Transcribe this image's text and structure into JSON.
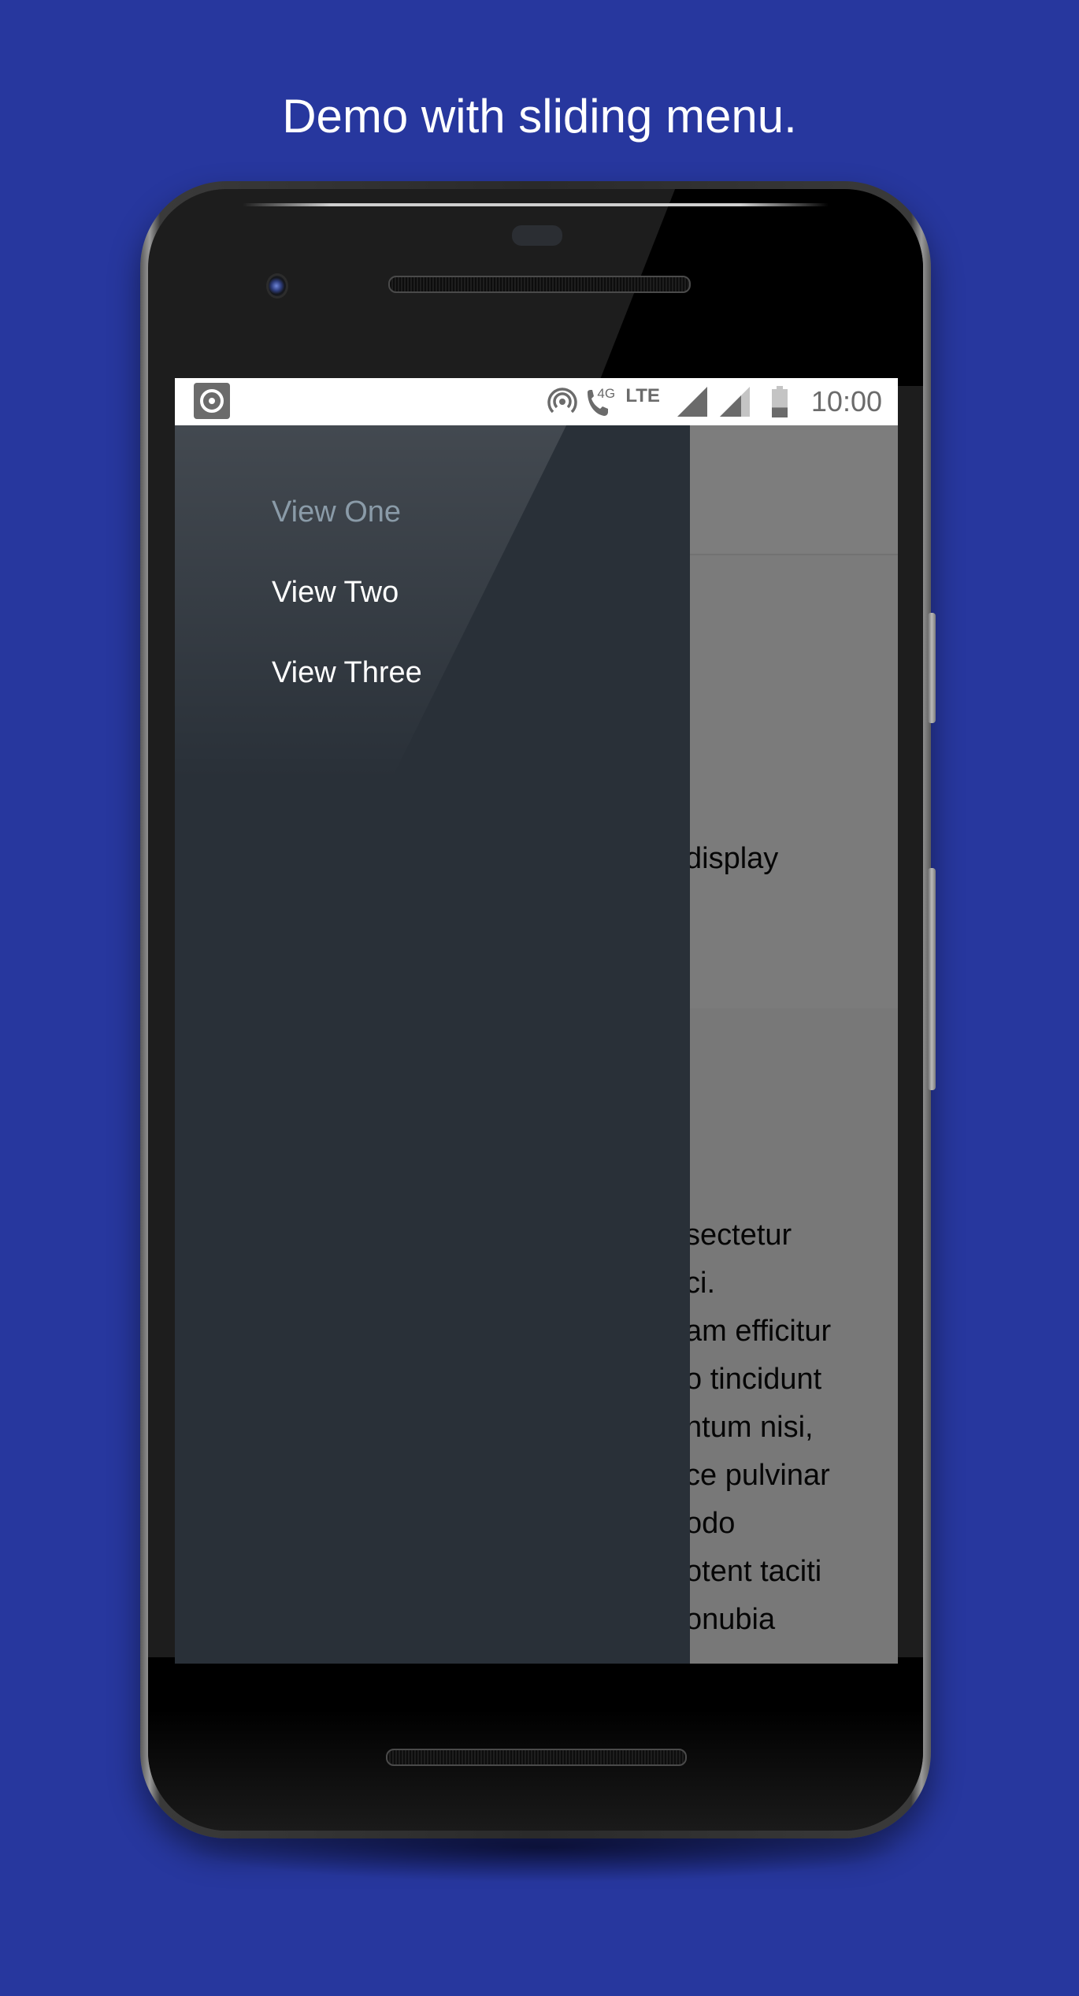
{
  "caption": "Demo with sliding menu.",
  "status_bar": {
    "app_icon": "notification-app-icon",
    "icons": [
      "hotspot-icon",
      "wifi-calling-icon",
      "lte-icon",
      "signal-icon",
      "signal-partial-icon",
      "battery-icon"
    ],
    "call_label": "4G",
    "network_label": "LTE",
    "time": "10:00",
    "battery_level_percent": 35
  },
  "drawer": {
    "items": [
      {
        "label": "View One",
        "active": true
      },
      {
        "label": "View Two",
        "active": false
      },
      {
        "label": "View Three",
        "active": false
      }
    ]
  },
  "main_content": {
    "heading_fragment": "display",
    "paragraph_fragments": [
      "sectetur",
      "ci.",
      "am efficitur",
      "o tincidunt",
      "ntum nisi,",
      "ce pulvinar",
      "odo",
      "otent taciti",
      "onubia"
    ]
  },
  "colors": {
    "background": "#27379e",
    "drawer": "#293038",
    "scrim": "#7b7b7b",
    "active_item": "#8a9ba8"
  }
}
